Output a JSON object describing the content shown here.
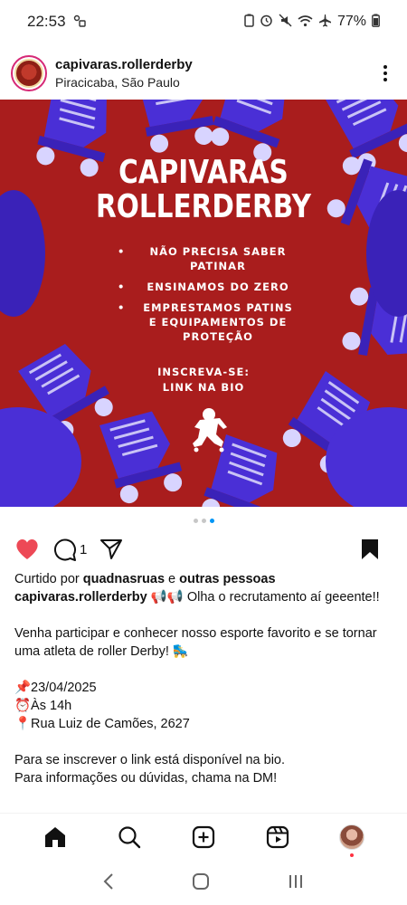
{
  "status_bar": {
    "time": "22:53",
    "battery": "77%"
  },
  "post": {
    "username": "capivaras.rollerderby",
    "location": "Piracicaba, São Paulo",
    "image": {
      "title_line1": "CAPIVARAS",
      "title_line2": "ROLLERDERBY",
      "bullet1": "NÃO PRECISA SABER PATINAR",
      "bullet2": "ENSINAMOS DO ZERO",
      "bullet3": "EMPRESTAMOS PATINS E EQUIPAMENTOS DE PROTEÇÃO",
      "cta_line1": "INSCREVA-SE:",
      "cta_line2": "LINK NA BIO",
      "colors": {
        "background": "#a91d1d",
        "skates": "#4a2fd6"
      }
    },
    "carousel": {
      "total": 3,
      "active_index": 2
    },
    "comment_count": "1",
    "liked": true,
    "saved": true,
    "liked_by_prefix": "Curtido por ",
    "liked_by_user": "quadnasruas",
    "liked_by_mid": " e ",
    "liked_by_others": "outras pessoas",
    "caption_user": "capivaras.rollerderby",
    "caption_first": " 📢📢 Olha o recrutamento aí geeente!!",
    "caption_para2": "Venha participar e conhecer nosso esporte favorito e se tornar uma atleta de roller Derby! 🛼",
    "date_line": "📌23/04/2025",
    "time_line": "⏰Às 14h",
    "address_line": "📍Rua Luiz de Camões, 2627",
    "info_line1": "Para se inscrever o link está disponível na bio.",
    "info_line2": "Para informações ou dúvidas, chama na DM!"
  },
  "icons": {
    "heart": "heart-icon",
    "comment": "comment-icon",
    "share": "share-icon",
    "bookmark": "bookmark-icon",
    "home": "home-icon",
    "search": "search-icon",
    "create": "create-icon",
    "reels": "reels-icon",
    "profile": "profile-avatar"
  },
  "colors": {
    "like": "#ed4956",
    "accent": "#0095f6"
  }
}
